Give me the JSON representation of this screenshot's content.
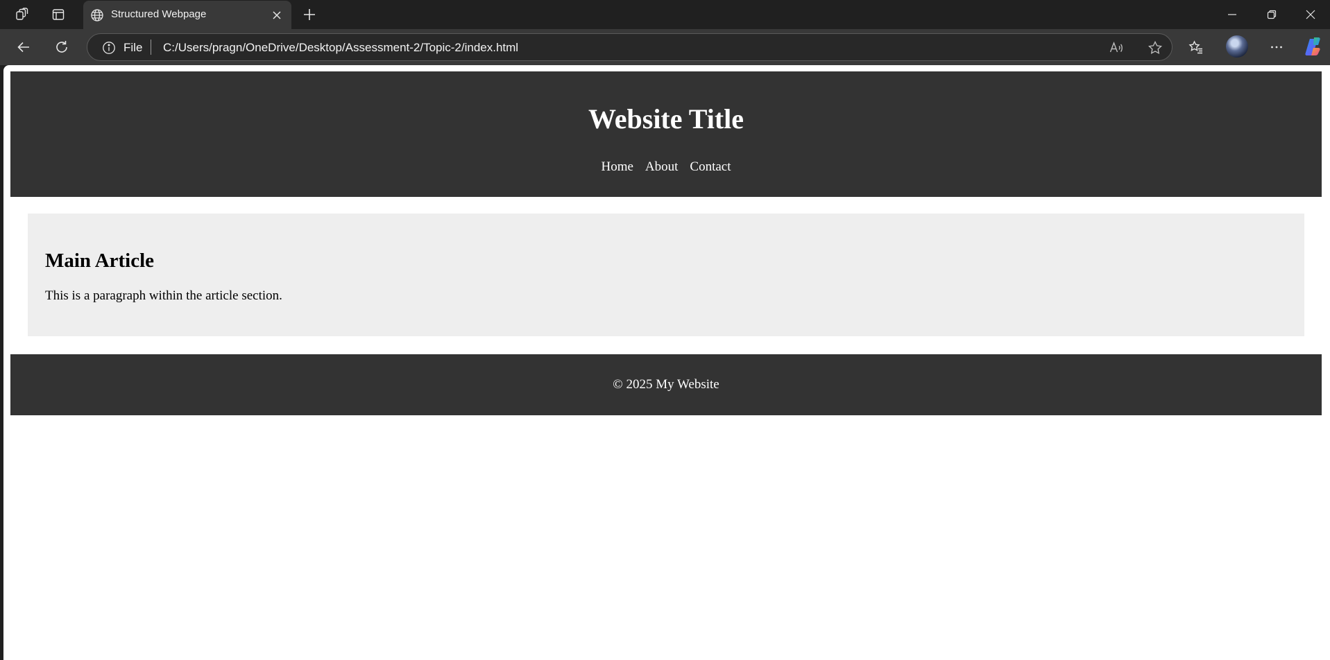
{
  "browser": {
    "tab": {
      "title": "Structured Webpage",
      "favicon": "globe-icon"
    },
    "toolbar": {
      "scheme_label": "File",
      "url": "C:/Users/pragn/OneDrive/Desktop/Assessment-2/Topic-2/index.html"
    },
    "icons": [
      "workspaces-icon",
      "vertical-tabs-icon",
      "new-tab-icon",
      "close-icon",
      "minimize-icon",
      "restore-icon",
      "back-arrow-icon",
      "refresh-icon",
      "info-icon",
      "read-aloud-icon",
      "favorite-star-icon",
      "favorites-list-icon",
      "more-menu-icon",
      "copilot-icon"
    ]
  },
  "page": {
    "header": {
      "title": "Website Title",
      "nav": [
        "Home",
        "About",
        "Contact"
      ]
    },
    "article": {
      "heading": "Main Article",
      "paragraph": "This is a paragraph within the article section."
    },
    "footer": {
      "text": "© 2025 My Website"
    }
  },
  "colors": {
    "browser_chrome": "#202020",
    "browser_toolbar": "#393939",
    "header_background": "#333333",
    "article_background": "#eeeeee",
    "footer_background": "#333333",
    "page_background": "#ffffff"
  }
}
